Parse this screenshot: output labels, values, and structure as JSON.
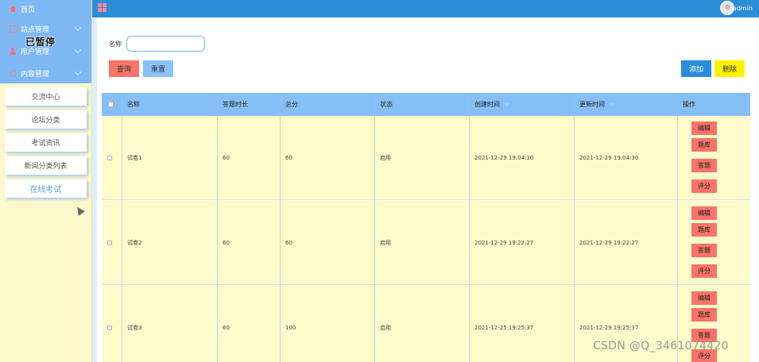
{
  "sidebar": {
    "menu": [
      {
        "label": "首页",
        "icon": "home-icon"
      },
      {
        "label": "站点管理",
        "icon": "site-icon"
      },
      {
        "label": "用户管理",
        "icon": "user-icon"
      },
      {
        "label": "内容管理",
        "icon": "content-icon"
      }
    ],
    "overlay_text": "已暂停",
    "submenu": [
      {
        "label": "交流中心"
      },
      {
        "label": "论坛分类"
      },
      {
        "label": "考试资讯"
      },
      {
        "label": "新闻分类列表"
      },
      {
        "label": "在线考试",
        "active": true
      }
    ]
  },
  "topbar": {
    "username": "admin",
    "colors": {
      "bar": "#2a8dd8",
      "sidebar_header": "#7fb9f5"
    }
  },
  "search": {
    "label": "名称",
    "value": "",
    "query_label": "查询",
    "reset_label": "重置"
  },
  "actions": {
    "add_label": "添加",
    "delete_label": "删除"
  },
  "table": {
    "columns": [
      "名称",
      "答题时长",
      "总分",
      "状态",
      "创建时间",
      "更新时间",
      "操作"
    ],
    "rows": [
      {
        "name": "试卷1",
        "duration": "60",
        "total": "60",
        "status": "启用",
        "created": "2021-12-29 19:04:30",
        "updated": "2021-12-29 19:04:30"
      },
      {
        "name": "试卷2",
        "duration": "60",
        "total": "60",
        "status": "启用",
        "created": "2021-12-29 19:22:27",
        "updated": "2021-12-29 19:22:27"
      },
      {
        "name": "试卷3",
        "duration": "60",
        "total": "100",
        "status": "启用",
        "created": "2021-12-25 19:25:37",
        "updated": "2021-12-29 19:25:37"
      }
    ],
    "row_ops": [
      "编辑",
      "题库",
      "答题",
      "评分"
    ]
  },
  "watermark": "CSDN @Q_3461074420"
}
